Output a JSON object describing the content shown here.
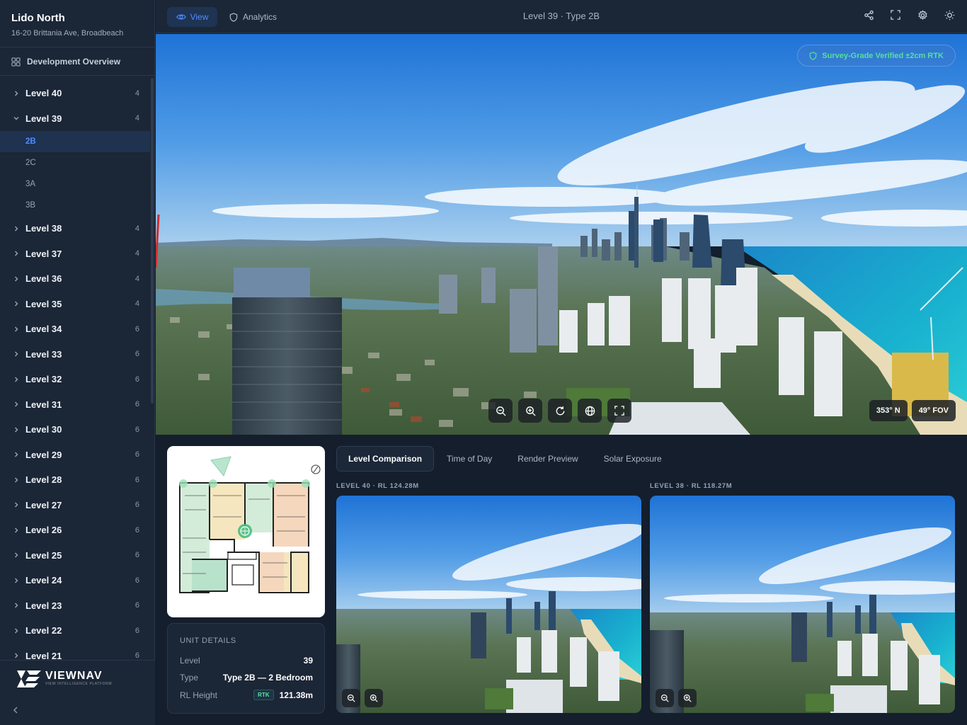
{
  "sidebar": {
    "project_name": "Lido North",
    "address": "16-20 Brittania Ave, Broadbeach",
    "overview_label": "Development Overview",
    "levels": [
      {
        "label": "Level 40",
        "count": "4",
        "expanded": false
      },
      {
        "label": "Level 39",
        "count": "4",
        "expanded": true,
        "units": [
          "2B",
          "2C",
          "3A",
          "3B"
        ],
        "active_unit": "2B"
      },
      {
        "label": "Level 38",
        "count": "4",
        "expanded": false
      },
      {
        "label": "Level 37",
        "count": "4",
        "expanded": false
      },
      {
        "label": "Level 36",
        "count": "4",
        "expanded": false
      },
      {
        "label": "Level 35",
        "count": "4",
        "expanded": false
      },
      {
        "label": "Level 34",
        "count": "6",
        "expanded": false
      },
      {
        "label": "Level 33",
        "count": "6",
        "expanded": false
      },
      {
        "label": "Level 32",
        "count": "6",
        "expanded": false
      },
      {
        "label": "Level 31",
        "count": "6",
        "expanded": false
      },
      {
        "label": "Level 30",
        "count": "6",
        "expanded": false
      },
      {
        "label": "Level 29",
        "count": "6",
        "expanded": false
      },
      {
        "label": "Level 28",
        "count": "6",
        "expanded": false
      },
      {
        "label": "Level 27",
        "count": "6",
        "expanded": false
      },
      {
        "label": "Level 26",
        "count": "6",
        "expanded": false
      },
      {
        "label": "Level 25",
        "count": "6",
        "expanded": false
      },
      {
        "label": "Level 24",
        "count": "6",
        "expanded": false
      },
      {
        "label": "Level 23",
        "count": "6",
        "expanded": false
      },
      {
        "label": "Level 22",
        "count": "6",
        "expanded": false
      },
      {
        "label": "Level 21",
        "count": "6",
        "expanded": false
      }
    ],
    "logo_text": "VIEWNAV",
    "logo_tagline": "VIEW INTELLIGENCE PLATFORM"
  },
  "topbar": {
    "view_label": "View",
    "analytics_label": "Analytics",
    "title": "Level 39 · Type 2B",
    "icons": [
      "share-icon",
      "fullscreen-icon",
      "settings-icon",
      "theme-icon"
    ]
  },
  "panorama": {
    "verified_badge": "Survey-Grade Verified ±2cm RTK",
    "heading": "353° N",
    "fov": "49° FOV",
    "controls": [
      "zoom-out-icon",
      "zoom-in-icon",
      "reset-icon",
      "globe-icon",
      "expand-icon"
    ]
  },
  "unit_details": {
    "heading": "UNIT DETAILS",
    "level_label": "Level",
    "level_value": "39",
    "type_label": "Type",
    "type_value": "Type 2B — 2 Bedroom",
    "rl_label": "RL Height",
    "rl_badge": "RTK",
    "rl_value": "121.38m"
  },
  "comparison": {
    "tabs": [
      "Level Comparison",
      "Time of Day",
      "Render Preview",
      "Solar Exposure"
    ],
    "active_tab": "Level Comparison",
    "left_label": "LEVEL 40 · RL 124.28M",
    "right_label": "LEVEL 38 · RL 118.27M"
  },
  "colors": {
    "accent": "#4f8cff",
    "verified": "#58e09a",
    "sidebar_bg": "#1b2636",
    "page_bg": "#141e2d"
  }
}
